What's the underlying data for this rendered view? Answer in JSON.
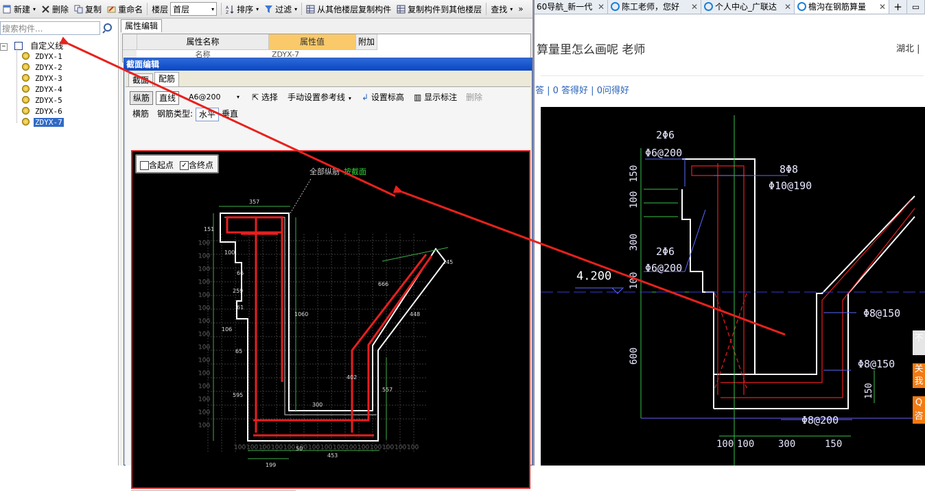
{
  "toolbar": {
    "new_label": "新建",
    "delete_label": "删除",
    "copy_label": "复制",
    "rename_label": "重命名",
    "floor_label": "楼层",
    "floor_value": "首层",
    "sort_label": "排序",
    "filter_label": "过滤",
    "copy_from_floor_label": "从其他楼层复制构件",
    "copy_to_floor_label": "复制构件到其他楼层",
    "find_label": "查找",
    "more_label": "»"
  },
  "left_panel": {
    "search_placeholder": "搜索构件...",
    "tree_root": "自定义线",
    "tree_items": [
      "ZDYX-1",
      "ZDYX-2",
      "ZDYX-3",
      "ZDYX-4",
      "ZDYX-5",
      "ZDYX-6",
      "ZDYX-7"
    ],
    "selected_item": "ZDYX-7"
  },
  "property_panel": {
    "tab_label": "属性编辑",
    "col_name": "属性名称",
    "col_value": "属性值",
    "col_extra": "附加",
    "row1_name": "名称",
    "row1_value": "ZDYX-7"
  },
  "section_dialog": {
    "title": "截面编辑",
    "tabs": [
      "截面",
      "配筋"
    ],
    "active_tab": "配筋",
    "toolbar": {
      "longitudinal_label": "纵筋",
      "straight_label": "直线",
      "rebar_spec": "A6@200",
      "select_label": "选择",
      "ref_line_label": "手动设置参考线",
      "set_elevation_label": "设置标高",
      "show_label_label": "显示标注",
      "delete_label": "删除"
    },
    "row2": {
      "transverse_label": "横筋",
      "rebar_type_label": "钢筋类型:",
      "horizontal_label": "水平",
      "vertical_label": "垂直"
    },
    "options": {
      "start_point_label": "含起点",
      "start_point_checked": false,
      "end_point_label": "含终点",
      "end_point_checked": true
    },
    "canvas_labels": {
      "all_long_label": "全部纵筋",
      "by_section_label": "按截面",
      "dims": [
        "357",
        "151",
        "100",
        "66",
        "259",
        "61",
        "106",
        "65",
        "595",
        "1060",
        "666",
        "145",
        "448",
        "402",
        "300",
        "557",
        "50",
        "199",
        "453"
      ],
      "grid_labels_left": [
        "100",
        "100",
        "100",
        "100",
        "100",
        "100",
        "100",
        "100",
        "100",
        "100",
        "100",
        "100",
        "100",
        "100",
        "100"
      ],
      "grid_labels_bottom": [
        "100",
        "100",
        "100",
        "100",
        "100",
        "100",
        "100",
        "100",
        "100",
        "100",
        "100",
        "100",
        "100",
        "100",
        "100"
      ]
    }
  },
  "browser": {
    "tabs": [
      {
        "label": "60导航_新一代",
        "active": false
      },
      {
        "label": "陈工老师，您好",
        "active": false
      },
      {
        "label": "个人中心_广联达",
        "active": false
      },
      {
        "label": "檐沟在钢筋算量",
        "active": true
      }
    ],
    "new_tab_label": "+",
    "question_title": "算量里怎么画呢 老师",
    "region": "湖北 |",
    "stats": "答 | 0 答得好 | 0问得好",
    "side_buttons": [
      "不",
      "关",
      "我",
      "Q",
      "咨"
    ],
    "cad_labels": {
      "top_left": [
        "2Φ6",
        "Φ6@200"
      ],
      "top_right": [
        "8Φ8",
        "Φ10@190"
      ],
      "mid_left": [
        "2Φ6",
        "Φ6@200"
      ],
      "elevation": "4.200",
      "right_1": "Φ8@150",
      "right_2": "Φ8@150",
      "bottom": "Φ8@200",
      "vert_dims": [
        "150",
        "100",
        "300",
        "100",
        "600"
      ],
      "small_dim": "150",
      "bottom_dims": [
        "100",
        "100",
        "300",
        "150"
      ]
    }
  },
  "colors": {
    "annotation_arrow": "#e8211c",
    "dialog_title": "#0a46c4",
    "selection": "#316ac5",
    "cad_green": "#39c24a",
    "cad_blue": "#5a6aff",
    "cad_red": "#e81e1e"
  }
}
